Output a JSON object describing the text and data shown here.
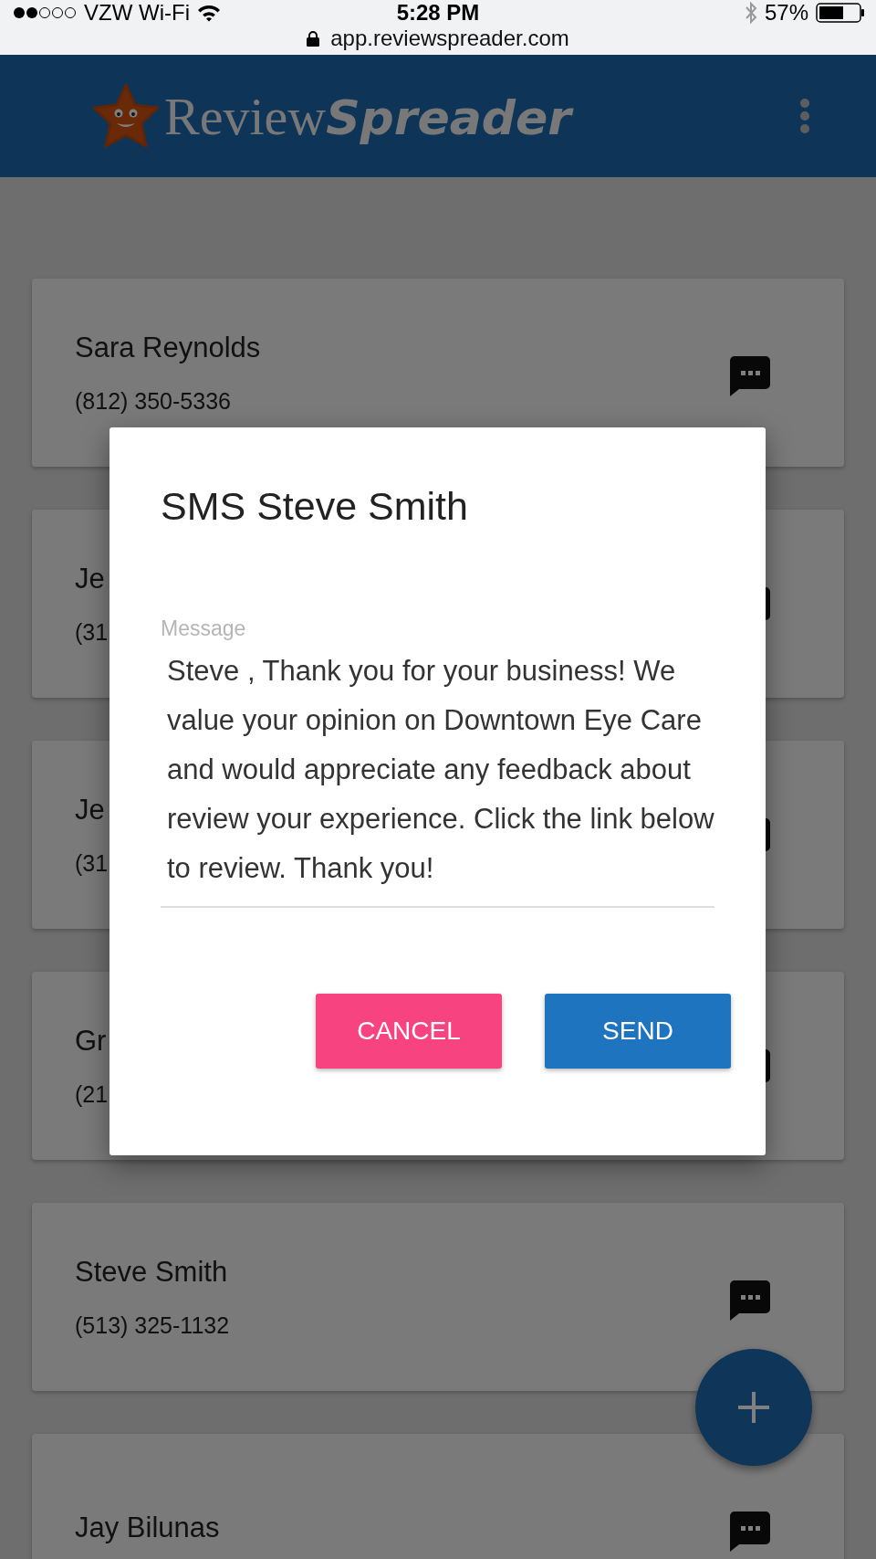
{
  "status_bar": {
    "carrier": "VZW Wi-Fi",
    "time": "5:28 PM",
    "battery": "57%"
  },
  "url_bar": {
    "url": "app.reviewspreader.com"
  },
  "header": {
    "logo_plain": "Review",
    "logo_bold": "Spreader"
  },
  "contacts": [
    {
      "name": "Sara Reynolds",
      "phone": "(812) 350-5336"
    },
    {
      "name": "Je",
      "phone": "(31"
    },
    {
      "name": "Je",
      "phone": "(31"
    },
    {
      "name": "Gr",
      "phone": "(21"
    },
    {
      "name": "Steve Smith",
      "phone": "(513) 325-1132"
    },
    {
      "name": "Jay Bilunas"
    }
  ],
  "dialog": {
    "title": "SMS Steve Smith",
    "field_label": "Message",
    "message": "Steve , Thank you for your business! We value your opinion on Downtown Eye Care and would appreciate any feedback about review your experience. Click the link below to review. Thank you!",
    "buttons": [
      {
        "label": "CANCEL",
        "kind": "cancel"
      },
      {
        "label": "SEND",
        "kind": "send"
      }
    ]
  }
}
